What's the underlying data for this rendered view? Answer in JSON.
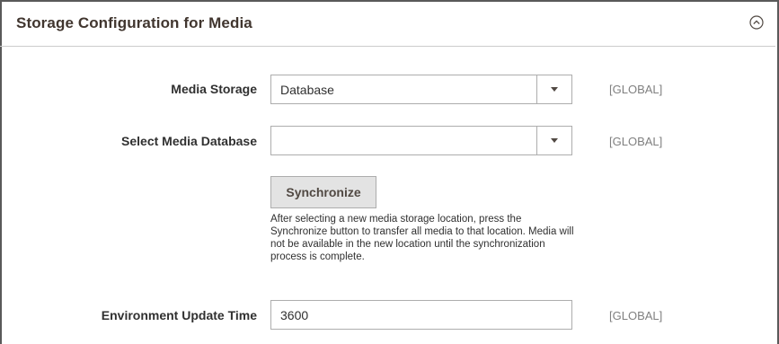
{
  "section": {
    "title": "Storage Configuration for Media",
    "collapse_icon": "chevron-up-circle-icon"
  },
  "fields": {
    "media_storage": {
      "label": "Media Storage",
      "value": "Database",
      "scope": "[GLOBAL]"
    },
    "media_database": {
      "label": "Select Media Database",
      "value": "",
      "scope": "[GLOBAL]"
    },
    "synchronize": {
      "button_label": "Synchronize",
      "note": "After selecting a new media storage location, press the Synchronize button to transfer all media to that location. Media will not be available in the new location until the synchronization process is complete."
    },
    "environment_update_time": {
      "label": "Environment Update Time",
      "value": "3600",
      "scope": "[GLOBAL]"
    }
  },
  "colors": {
    "title": "#41362f",
    "border": "#adadad",
    "scope_text": "#808080",
    "button_bg": "#e3e3e3"
  }
}
